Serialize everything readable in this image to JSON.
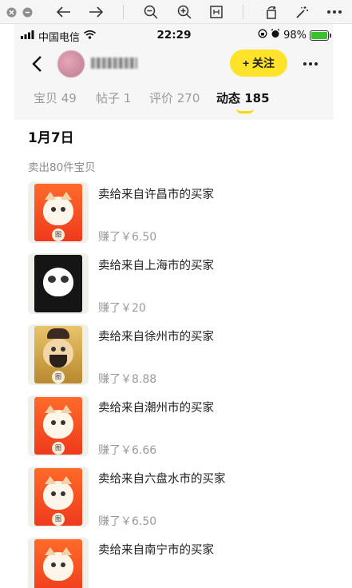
{
  "viewer": {
    "icons": [
      "close-icon",
      "minimize-icon",
      "back-arrow-icon",
      "forward-arrow-icon",
      "zoom-out-icon",
      "zoom-in-icon",
      "fit-icon",
      "rotate-icon",
      "magic-wand-icon",
      "more-icon"
    ]
  },
  "status_bar": {
    "carrier": "中国电信",
    "time": "22:29",
    "battery": "98%",
    "battery_level": 0.98
  },
  "header": {
    "follow_label": "+ 关注"
  },
  "tabs": [
    {
      "label": "宝贝 49"
    },
    {
      "label": "帖子 1"
    },
    {
      "label": "评价 270"
    },
    {
      "label": "动态 185"
    }
  ],
  "feed": {
    "date": "1月7日",
    "summary": "卖出80件宝贝",
    "items": [
      {
        "title": "卖给来自许昌市的买家",
        "earned": "赚了￥6.50",
        "thumb": "cat-sticker"
      },
      {
        "title": "卖给来自上海市的买家",
        "earned": "赚了￥20",
        "thumb": "panda-sticker"
      },
      {
        "title": "卖给来自徐州市的买家",
        "earned": "赚了￥8.88",
        "thumb": "god-of-wealth-sticker"
      },
      {
        "title": "卖给来自潮州市的买家",
        "earned": "赚了￥6.66",
        "thumb": "cat-sticker"
      },
      {
        "title": "卖给来自六盘水市的买家",
        "earned": "赚了￥6.50",
        "thumb": "cat-sticker"
      },
      {
        "title": "卖给来自南宁市的买家",
        "earned": "",
        "thumb": "cat-sticker"
      }
    ],
    "tag_char": "图"
  },
  "colors": {
    "accent_yellow": "#ffe32a",
    "sticker_orange": "#ee3a1c"
  }
}
